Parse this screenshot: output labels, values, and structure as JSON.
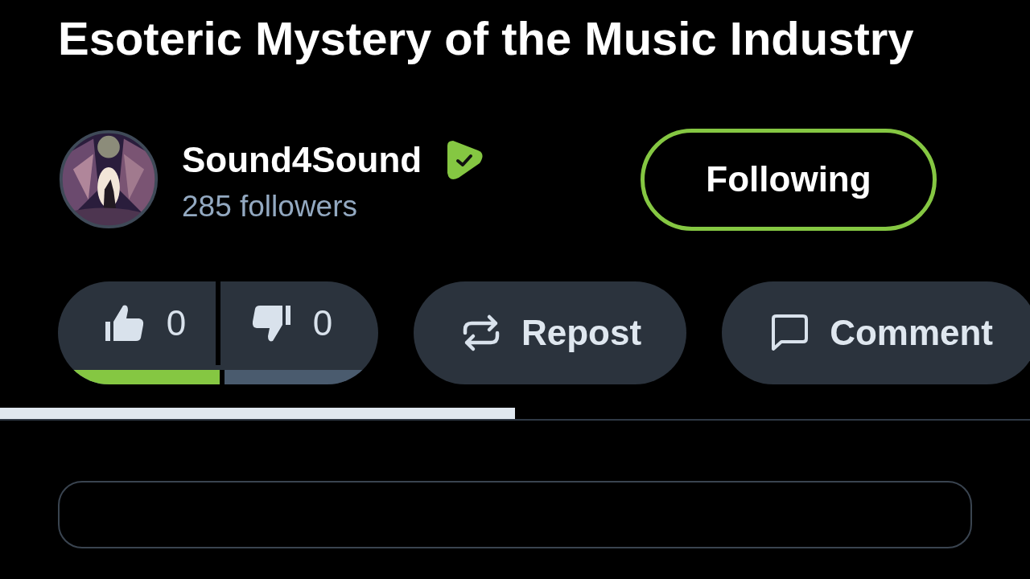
{
  "video": {
    "title": "Esoteric Mystery of the Music Industry"
  },
  "channel": {
    "name": "Sound4Sound",
    "verified": true,
    "followers": "285 followers",
    "follow_button": {
      "label": "Following",
      "following": true
    }
  },
  "actions": {
    "like": {
      "count": "0"
    },
    "dislike": {
      "count": "0"
    },
    "like_ratio": {
      "level": 0.5
    },
    "buttons": [
      {
        "kind": "repost",
        "label": "Repost"
      },
      {
        "kind": "comment",
        "label": "Comment"
      }
    ]
  },
  "progress": {
    "level": 0.5
  },
  "panel": {
    "kind": "card"
  }
}
